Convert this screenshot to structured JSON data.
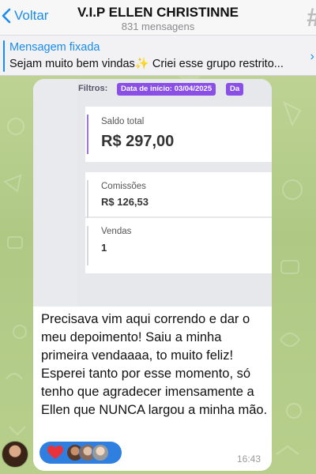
{
  "header": {
    "back_label": "Voltar",
    "title": "V.I.P ELLEN CHRISTINNE",
    "subtitle": "831 mensagens"
  },
  "pinned": {
    "label": "Mensagem fixada",
    "text": "Sejam muito bem vindas✨ Criei esse grupo restrito..."
  },
  "message": {
    "screenshot": {
      "filters_label": "Filtros:",
      "chips": [
        "Data de início: 03/04/2025",
        "Da"
      ],
      "cards": [
        {
          "label": "Saldo total",
          "value": "R$ 297,00"
        },
        {
          "label": "Comissões",
          "value": "R$ 126,53"
        },
        {
          "label": "Vendas",
          "value": "1"
        }
      ]
    },
    "text": "Precisava vim aqui correndo e dar o meu depoimento! Saiu a minha primeira vendaaaa, to muito feliz! Esperei tanto por esse momento, só tenho que agradecer imensamente a Ellen que NUNCA largou a minha mão.",
    "time": "16:43",
    "reactions": {
      "emoji": "heart-icon",
      "color": "#2f7fe0"
    }
  },
  "colors": {
    "accent": "#1a8cf0",
    "chip": "#8a4fe6",
    "wallpaper": "#b9cf8f"
  }
}
